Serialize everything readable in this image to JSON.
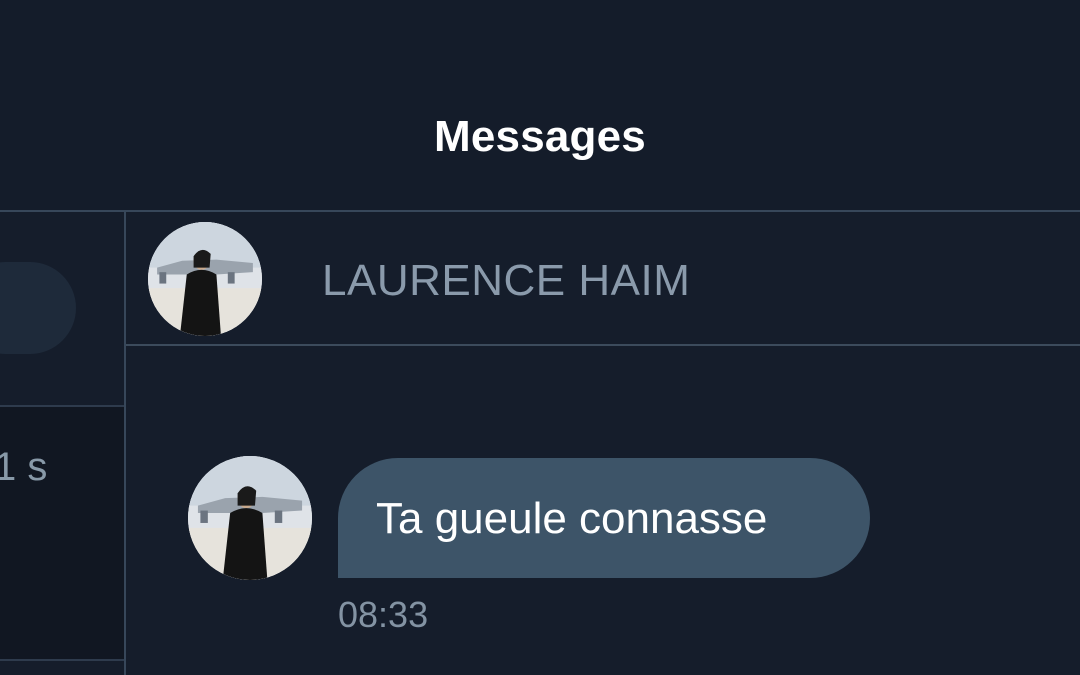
{
  "header": {
    "title": "Messages"
  },
  "sidebar": {
    "item_time": "1 s"
  },
  "conversation": {
    "name": "LAURENCE HAIM",
    "avatar_icon": "user-avatar-photo"
  },
  "messages": [
    {
      "text": "Ta gueule connasse",
      "time": "08:33",
      "avatar_icon": "user-avatar-photo"
    }
  ],
  "colors": {
    "background": "#151d2b",
    "divider": "#37475a",
    "bubble": "#3d5468",
    "name_text": "#8a9aab",
    "time_text": "#8393a3"
  }
}
